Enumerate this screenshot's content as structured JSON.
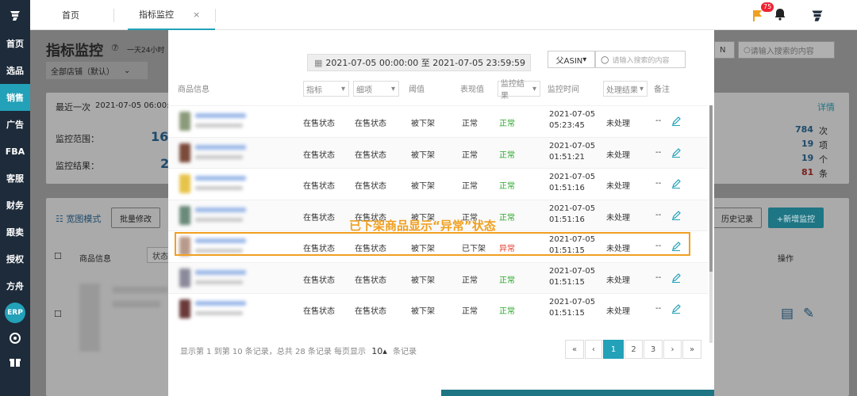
{
  "sidebar": {
    "items": [
      {
        "label": "首页",
        "active": false
      },
      {
        "label": "选品",
        "active": false
      },
      {
        "label": "销售",
        "active": true
      },
      {
        "label": "广告",
        "active": false
      },
      {
        "label": "FBA",
        "active": false
      },
      {
        "label": "客服",
        "active": false
      },
      {
        "label": "财务",
        "active": false
      },
      {
        "label": "跟卖",
        "active": false
      },
      {
        "label": "授权",
        "active": false
      },
      {
        "label": "方舟",
        "active": false
      },
      {
        "label": "ERP",
        "active": false
      }
    ]
  },
  "topbar": {
    "tabs": [
      "首页",
      "指标监控"
    ],
    "close": "×",
    "notification_count": "75"
  },
  "background": {
    "title": "指标监控",
    "subtitle": "一天24小时",
    "store_select": "全部店铺（默认）",
    "recent_label": "最近一次",
    "recent_time": "2021-07-05 06:00:0",
    "detail_link": "详情",
    "scope_label": "监控范围：",
    "scope_value": "16",
    "result_label": "监控结果：",
    "result_value": "2",
    "stats": [
      {
        "value": "784",
        "unit": "次"
      },
      {
        "value": "19",
        "unit": "项"
      },
      {
        "value": "19",
        "unit": "个"
      },
      {
        "value": "81",
        "unit": "条"
      }
    ],
    "mode_label": "宽图模式",
    "batch_button": "批量修改",
    "history_button": "历史记录",
    "add_button": "+新增监控",
    "col_product": "商品信息",
    "col_status": "状态",
    "col_ops": "操作",
    "asin_select_right": "N",
    "search_placeholder_right": "请输入搜索的内容"
  },
  "modal": {
    "date_range": "2021-07-05 00:00:00 至 2021-07-05 23:59:59",
    "asin_select": "父ASIN",
    "search_placeholder": "请输入搜索的内容",
    "headers": {
      "product": "商品信息",
      "metric": "指标",
      "detail": "细项",
      "threshold": "阈值",
      "value": "表现值",
      "result": "监控结果",
      "time": "监控时间",
      "handle": "处理结果",
      "note": "备注"
    },
    "rows": [
      {
        "metric": "在售状态",
        "detail": "在售状态",
        "threshold": "被下架",
        "value": "正常",
        "result": "正常",
        "date": "2021-07-05",
        "time": "05:23:45",
        "handle": "未处理",
        "note": "--",
        "abnormal": false
      },
      {
        "metric": "在售状态",
        "detail": "在售状态",
        "threshold": "被下架",
        "value": "正常",
        "result": "正常",
        "date": "2021-07-05",
        "time": "01:51:21",
        "handle": "未处理",
        "note": "--",
        "abnormal": false
      },
      {
        "metric": "在售状态",
        "detail": "在售状态",
        "threshold": "被下架",
        "value": "正常",
        "result": "正常",
        "date": "2021-07-05",
        "time": "01:51:16",
        "handle": "未处理",
        "note": "--",
        "abnormal": false
      },
      {
        "metric": "在售状态",
        "detail": "在售状态",
        "threshold": "被下架",
        "value": "正常",
        "result": "正常",
        "date": "2021-07-05",
        "time": "01:51:16",
        "handle": "未处理",
        "note": "--",
        "abnormal": false
      },
      {
        "metric": "在售状态",
        "detail": "在售状态",
        "threshold": "被下架",
        "value": "已下架",
        "result": "异常",
        "date": "2021-07-05",
        "time": "01:51:15",
        "handle": "未处理",
        "note": "--",
        "abnormal": true
      },
      {
        "metric": "在售状态",
        "detail": "在售状态",
        "threshold": "被下架",
        "value": "正常",
        "result": "正常",
        "date": "2021-07-05",
        "time": "01:51:15",
        "handle": "未处理",
        "note": "--",
        "abnormal": false
      },
      {
        "metric": "在售状态",
        "detail": "在售状态",
        "threshold": "被下架",
        "value": "正常",
        "result": "正常",
        "date": "2021-07-05",
        "time": "01:51:15",
        "handle": "未处理",
        "note": "--",
        "abnormal": false
      }
    ],
    "annotation": "已下架商品显示“异常”状态",
    "footer": "显示第 1 到第 10 条记录，总共 28 条记录 每页显示",
    "page_size": "10",
    "footer_suffix": "条记录",
    "pagination": [
      "«",
      "‹",
      "1",
      "2",
      "3",
      "›",
      "»"
    ],
    "current_page": "1"
  },
  "colors": {
    "accent": "#22a1b8",
    "sidebar": "#1d2b3a",
    "normal": "#2aa52a",
    "abnormal": "#e23b2b",
    "highlight": "#f0a020"
  }
}
